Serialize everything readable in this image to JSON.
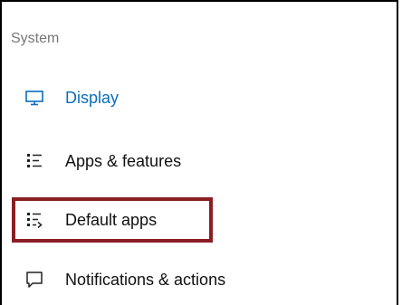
{
  "section": {
    "title": "System"
  },
  "nav": {
    "items": [
      {
        "label": "Display",
        "icon": "monitor-icon",
        "active": true
      },
      {
        "label": "Apps & features",
        "icon": "apps-list-icon",
        "active": false
      },
      {
        "label": "Default apps",
        "icon": "default-apps-icon",
        "active": false
      },
      {
        "label": "Notifications & actions",
        "icon": "notification-icon",
        "active": false
      }
    ]
  },
  "colors": {
    "accent": "#0a6fbf",
    "highlight_border": "#8b1e24",
    "header_text": "#777777"
  }
}
